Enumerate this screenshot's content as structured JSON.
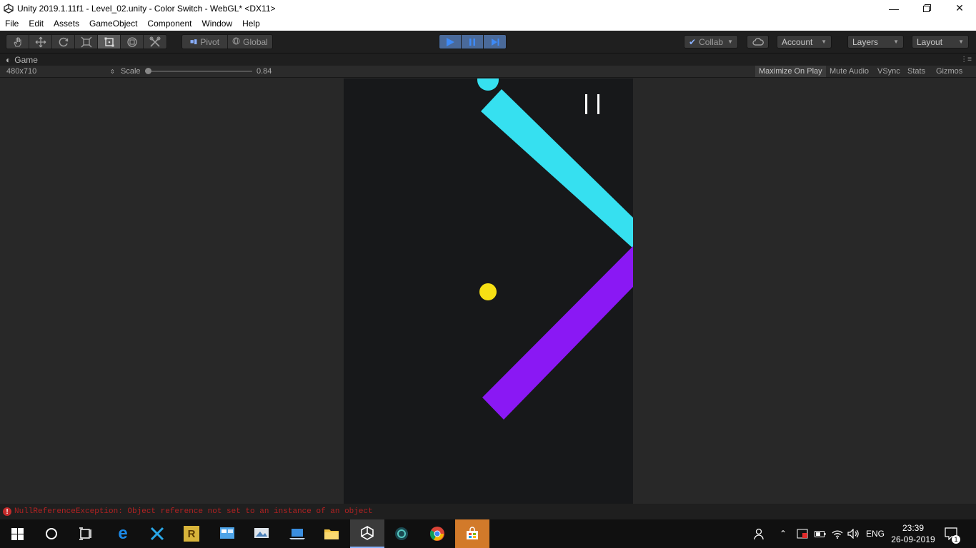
{
  "window": {
    "title": "Unity 2019.1.11f1 - Level_02.unity - Color Switch - WebGL* <DX11>",
    "controls": [
      "minimize-icon",
      "restore-icon",
      "close-icon"
    ]
  },
  "menu": {
    "items": [
      "File",
      "Edit",
      "Assets",
      "GameObject",
      "Component",
      "Window",
      "Help"
    ]
  },
  "toolbar": {
    "tools": [
      "hand-icon",
      "move-icon",
      "rotate-icon",
      "scale-icon",
      "rect-icon",
      "transform-icon",
      "custom-tool-icon"
    ],
    "active_tool": "rect-icon",
    "pivot_label": "Pivot",
    "global_label": "Global",
    "play_controls": [
      "play-icon",
      "pause-icon",
      "step-icon"
    ],
    "collab_label": "Collab",
    "account_label": "Account",
    "layers_label": "Layers",
    "layout_label": "Layout"
  },
  "game_tab": {
    "label": "Game",
    "resolution": "480x710",
    "scale_label": "Scale",
    "scale_value": "0.84",
    "maximize_label": "Maximize On Play",
    "mute_label": "Mute Audio",
    "vsync_label": "VSync",
    "stats_label": "Stats",
    "gizmos_label": "Gizmos"
  },
  "game": {
    "colors": {
      "cyan": "#36e0f0",
      "purple": "#8a18f4",
      "yellow": "#f7e014",
      "background": "#17181a"
    },
    "pause_icon": "pause-bars-icon"
  },
  "status": {
    "error_text": "NullReferenceException: Object reference not set to an instance of an object"
  },
  "taskbar": {
    "apps": [
      "windows-start-icon",
      "cortana-icon",
      "task-view-icon",
      "edge-icon",
      "tools-icon",
      "r-app-icon",
      "control-panel-icon",
      "photos-icon",
      "laptop-icon",
      "file-explorer-icon",
      "unity-icon",
      "game-icon",
      "chrome-icon",
      "store-icon"
    ],
    "active_app": "unity-icon",
    "lang": "ENG",
    "time": "23:39",
    "date": "26-09-2019",
    "notifications": "1"
  }
}
